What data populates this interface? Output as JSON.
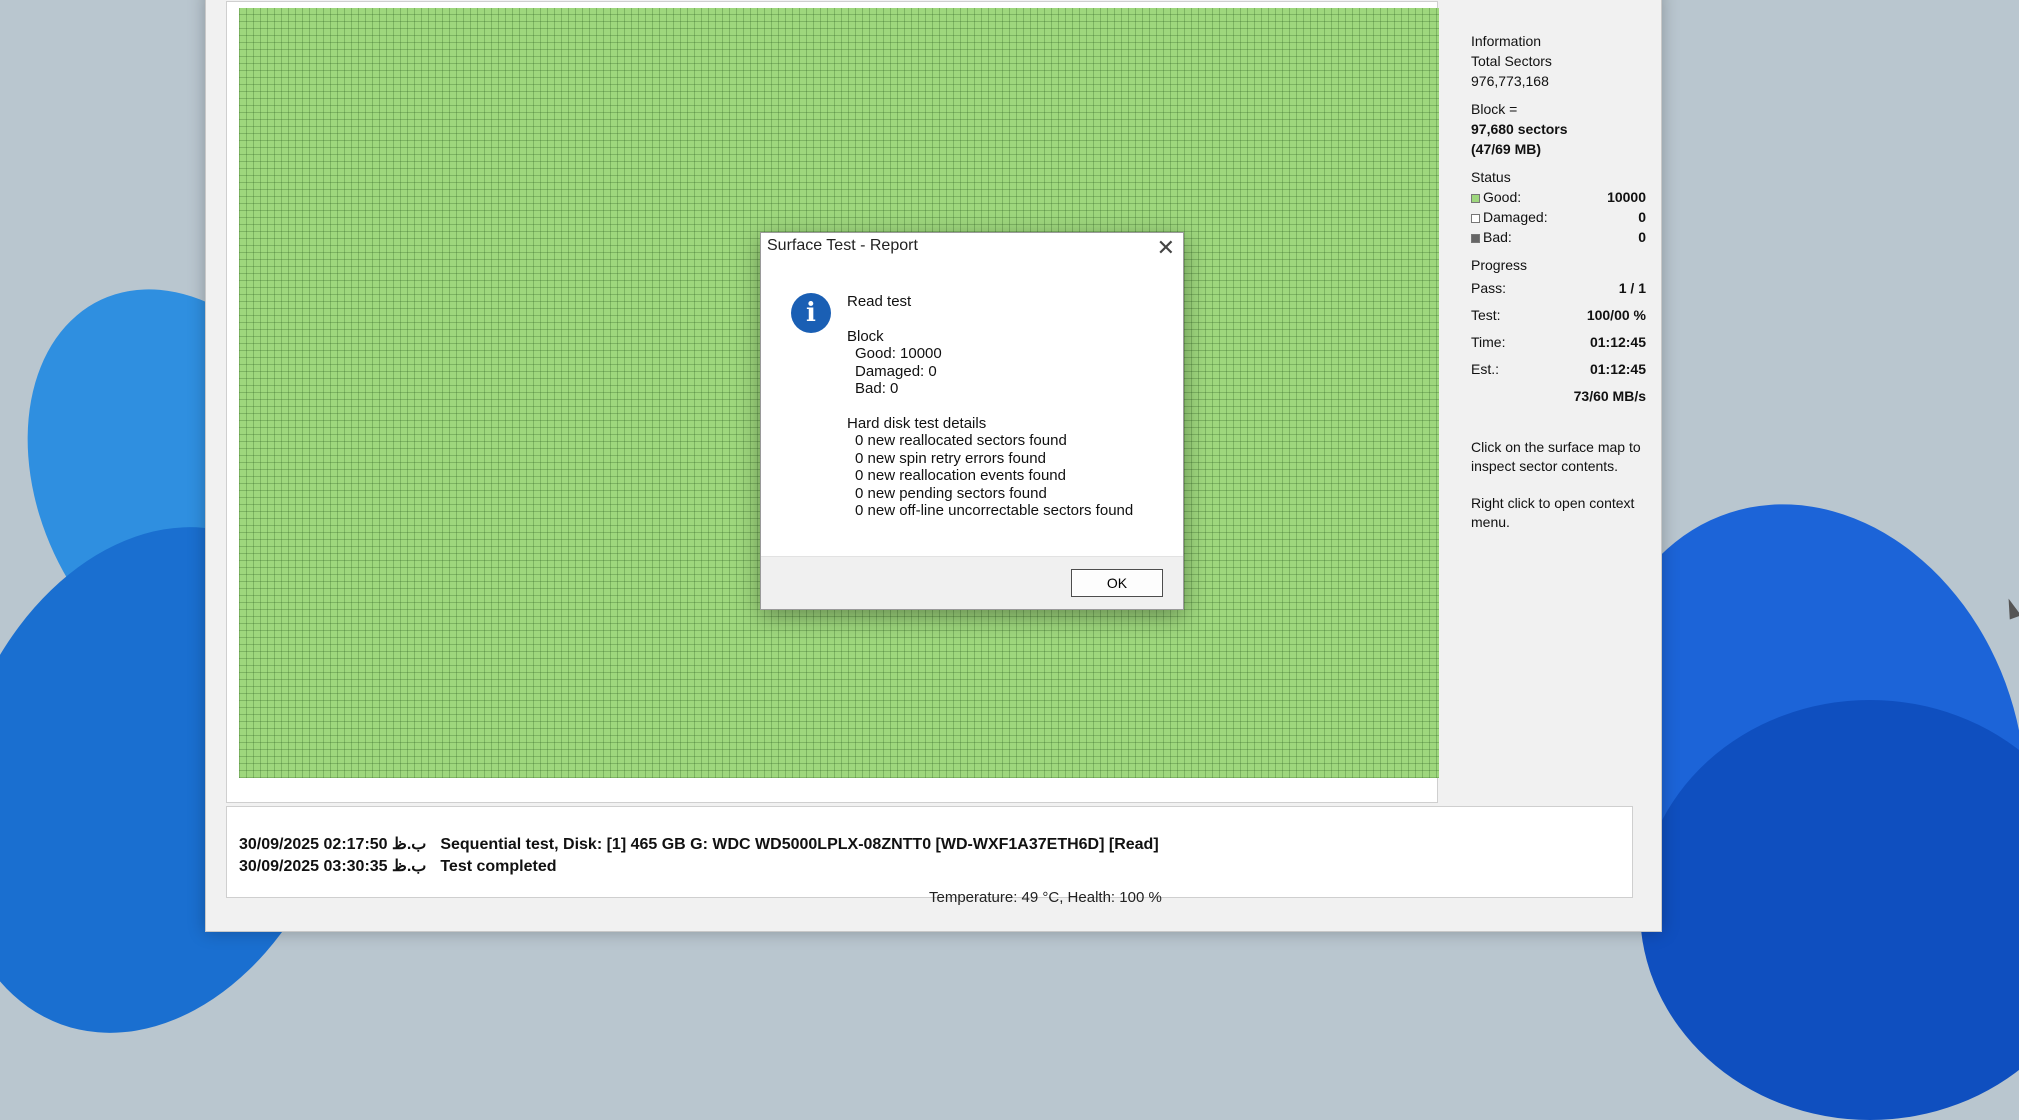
{
  "info": {
    "heading": "Information",
    "total_sectors_label": "Total Sectors",
    "total_sectors_value": "976,773,168",
    "block_label": "Block =",
    "block_sectors": "97,680 sectors",
    "block_size": "(47/69 MB)"
  },
  "status": {
    "heading": "Status",
    "good_label": "Good:",
    "good_value": "10000",
    "damaged_label": "Damaged:",
    "damaged_value": "0",
    "bad_label": "Bad:",
    "bad_value": "0"
  },
  "progress": {
    "heading": "Progress",
    "pass_label": "Pass:",
    "pass_value": "1 / 1",
    "test_label": "Test:",
    "test_value": "100/00 %",
    "time_label": "Time:",
    "time_value": "01:12:45",
    "est_label": "Est.:",
    "est_value": "01:12:45",
    "speed": "73/60 MB/s"
  },
  "hints": {
    "surface": "Click on the surface map to inspect sector contents.",
    "context": "Right click to open context menu."
  },
  "log": [
    {
      "time": "30/09/2025 02:17:50 ب.ظ",
      "message": "Sequential test, Disk: [1] 465 GB G: WDC WD5000LPLX-08ZNTT0 [WD-WXF1A37ETH6D] [Read]"
    },
    {
      "time": "30/09/2025 03:30:35 ب.ظ",
      "message": "Test completed"
    }
  ],
  "status_bar": "Temperature: 49  °C,  Health: 100 %",
  "dialog": {
    "title": "Surface Test - Report",
    "close": "✕",
    "icon_name": "info-icon",
    "test_type": "Read test",
    "block_heading": "Block",
    "good_line": "Good: 10000",
    "damaged_line": "Damaged: 0",
    "bad_line": "Bad: 0",
    "details_heading": "Hard disk test details",
    "details": [
      "0 new reallocated sectors found",
      "0 new spin retry errors found",
      "0 new reallocation events found",
      "0 new pending sectors found",
      "0 new off-line uncorrectable sectors found"
    ],
    "ok_label": "OK"
  },
  "colors": {
    "good_block": "#9ed77d",
    "info_icon": "#1a5fb4"
  }
}
